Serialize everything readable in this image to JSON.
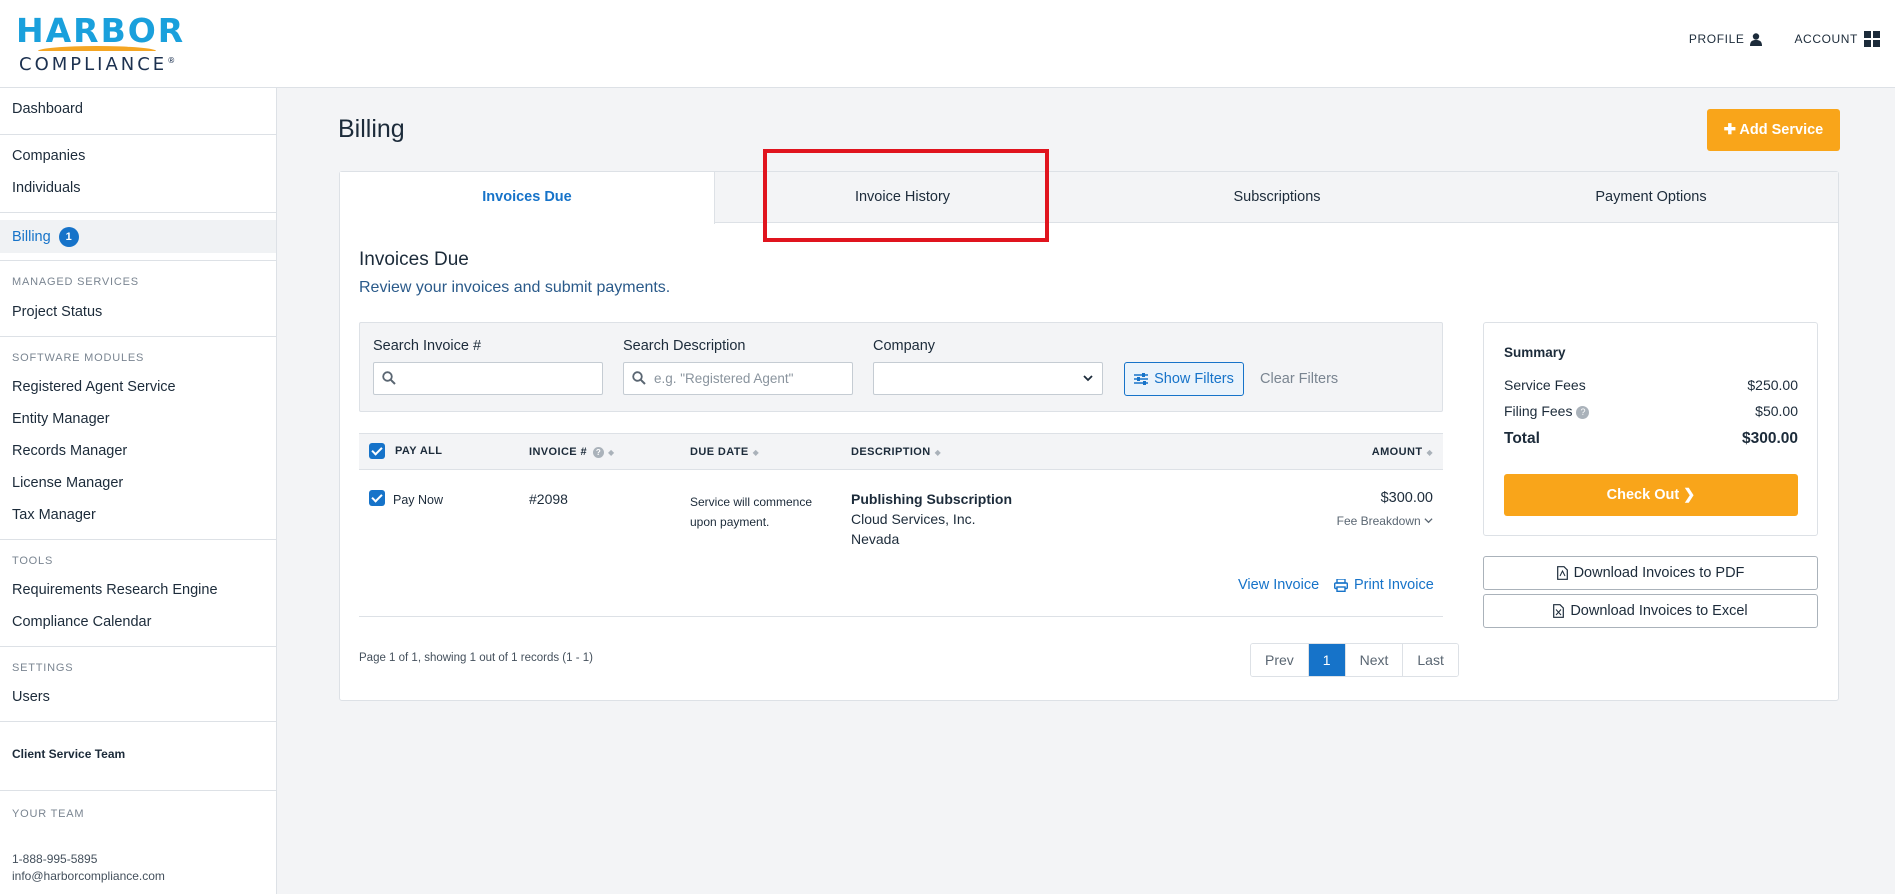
{
  "brand": {
    "name_top": "HARBOR",
    "name_bottom": "COMPLIANCE",
    "mark": "®",
    "accent": "#1aa0dc",
    "swoosh": "#f9a51a"
  },
  "topnav": {
    "profile": "PROFILE",
    "account": "ACCOUNT"
  },
  "sidebar": {
    "dashboard": "Dashboard",
    "companies": "Companies",
    "individuals": "Individuals",
    "billing": "Billing",
    "billing_badge": "1",
    "managed_services": "MANAGED SERVICES",
    "project_status": "Project Status",
    "software_modules": "SOFTWARE MODULES",
    "registered_agent": "Registered Agent Service",
    "entity_manager": "Entity Manager",
    "records_manager": "Records Manager",
    "license_manager": "License Manager",
    "tax_manager": "Tax Manager",
    "tools": "TOOLS",
    "requirements": "Requirements Research Engine",
    "calendar": "Compliance Calendar",
    "settings": "SETTINGS",
    "users": "Users",
    "your_team": "YOUR TEAM",
    "team_name": "Client Service Team",
    "team_phone": "1-888-995-5895",
    "team_email": "info@harborcompliance.com"
  },
  "page": {
    "title": "Billing",
    "add_service": "Add Service",
    "tabs": [
      "Invoices Due",
      "Invoice History",
      "Subscriptions",
      "Payment Options"
    ],
    "section_title": "Invoices Due",
    "section_subtitle": "Review your invoices and submit payments."
  },
  "filters": {
    "search_invoice_label": "Search Invoice #",
    "search_invoice_placeholder": "",
    "search_desc_label": "Search Description",
    "search_desc_placeholder": "e.g. \"Registered Agent\"",
    "company_label": "Company",
    "show_filters": "Show Filters",
    "clear_filters": "Clear Filters"
  },
  "table": {
    "headers": {
      "pay_all": "PAY ALL",
      "invoice": "INVOICE #",
      "due_date": "DUE DATE",
      "description": "DESCRIPTION",
      "amount": "AMOUNT"
    },
    "rows": [
      {
        "pay": "Pay Now",
        "invoice": "#2098",
        "due": "Service will commence upon payment.",
        "desc_title": "Publishing Subscription",
        "desc_company": "Cloud Services, Inc.",
        "desc_state": "Nevada",
        "amount": "$300.00",
        "fee_breakdown": "Fee Breakdown"
      }
    ],
    "view_invoice": "View Invoice",
    "print_invoice": "Print Invoice"
  },
  "pagination": {
    "info": "Page 1 of 1, showing 1 out of 1 records (1 - 1)",
    "prev": "Prev",
    "current": "1",
    "next": "Next",
    "last": "Last"
  },
  "summary": {
    "title": "Summary",
    "service_fees_label": "Service Fees",
    "service_fees": "$250.00",
    "filing_fees_label": "Filing Fees",
    "filing_fees": "$50.00",
    "total_label": "Total",
    "total": "$300.00",
    "checkout": "Check Out"
  },
  "downloads": {
    "pdf": "Download Invoices to PDF",
    "excel": "Download Invoices to Excel"
  },
  "colors": {
    "primary": "#1673c9",
    "accent": "#f9a51a",
    "highlight": "#e0141e"
  }
}
